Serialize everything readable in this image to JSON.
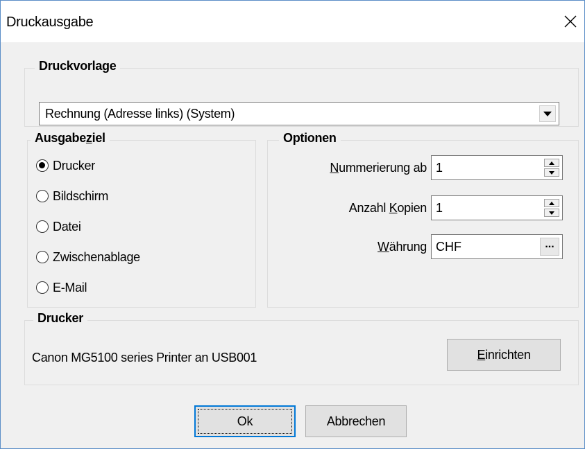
{
  "window": {
    "title": "Druckausgabe",
    "close_icon": "close-icon"
  },
  "druckvorlage": {
    "group_title": "Druckvorlage",
    "selected": "Rechnung (Adresse links) (System)"
  },
  "ausgabeziel": {
    "group_title_pre": "Ausgabe",
    "group_title_acc": "z",
    "group_title_post": "iel",
    "options": [
      {
        "label": "Drucker",
        "checked": true
      },
      {
        "label": "Bildschirm",
        "checked": false
      },
      {
        "label": "Datei",
        "checked": false
      },
      {
        "label": "Zwischenablage",
        "checked": false
      },
      {
        "label": "E-Mail",
        "checked": false
      }
    ]
  },
  "optionen": {
    "group_title": "Optionen",
    "nummerierung": {
      "label_acc": "N",
      "label_rest": "ummerierung ab",
      "value": "1"
    },
    "kopien": {
      "label_pre": "Anzahl ",
      "label_acc": "K",
      "label_rest": "opien",
      "value": "1"
    },
    "waehrung": {
      "label_acc": "W",
      "label_rest": "ährung",
      "value": "CHF",
      "button": "..."
    }
  },
  "drucker": {
    "group_title": "Drucker",
    "printer_name": "Canon MG5100 series Printer an USB001",
    "setup_acc": "E",
    "setup_rest": "inrichten"
  },
  "footer": {
    "ok": "Ok",
    "cancel": "Abbrechen"
  }
}
